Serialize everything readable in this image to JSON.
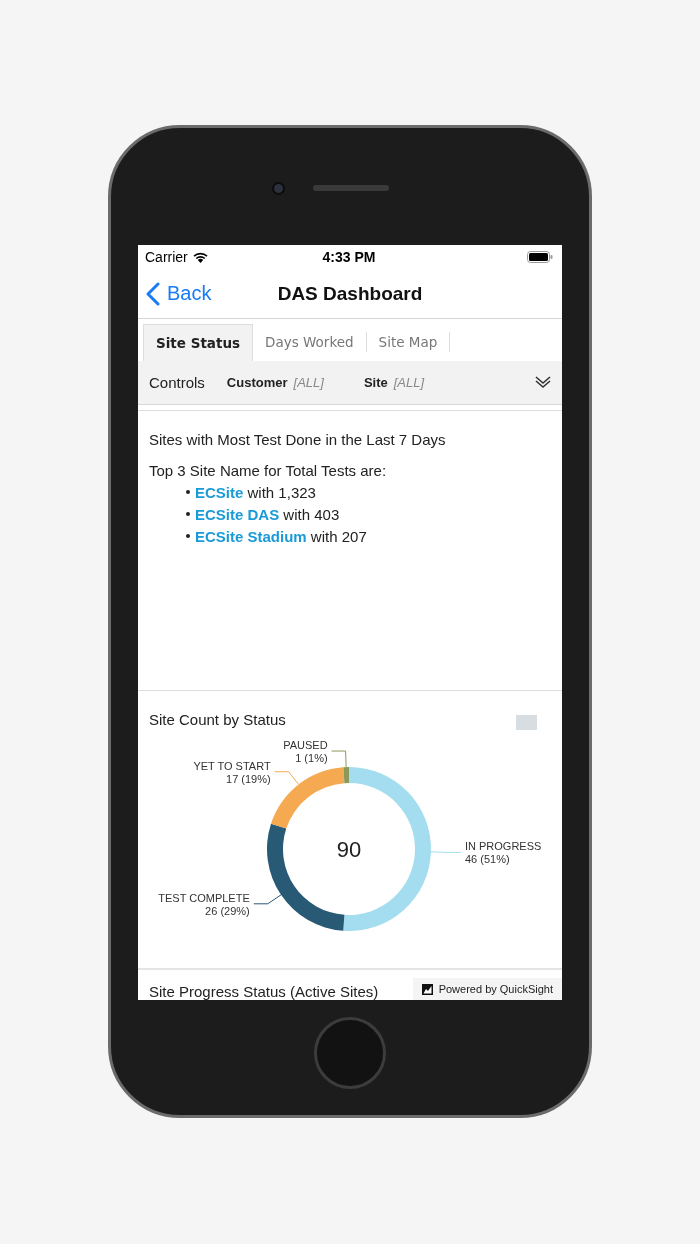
{
  "status_bar": {
    "carrier": "Carrier",
    "time": "4:33 PM"
  },
  "nav": {
    "back": "Back",
    "title": "DAS Dashboard"
  },
  "tabs": [
    {
      "label": "Site Status",
      "selected": true
    },
    {
      "label": "Days Worked",
      "selected": false
    },
    {
      "label": "Site Map",
      "selected": false
    }
  ],
  "controls": {
    "label": "Controls",
    "filters": [
      {
        "name": "Customer",
        "value": "[ALL]"
      },
      {
        "name": "Site",
        "value": "[ALL]"
      }
    ]
  },
  "insight": {
    "title": "Sites with Most Test Done in the Last 7 Days",
    "intro": "Top 3 Site Name for Total Tests are:",
    "items": [
      {
        "site": "ECSite",
        "detail": "with 1,323"
      },
      {
        "site": "ECSite DAS",
        "detail": "with 403"
      },
      {
        "site": "ECSite Stadium",
        "detail": "with 207"
      }
    ]
  },
  "chart_panel": {
    "title": "Site Count by Status",
    "center_label": "90",
    "chart_data": {
      "type": "donut",
      "categories": [
        "IN PROGRESS",
        "TEST COMPLETE",
        "YET TO START",
        "PAUSED"
      ],
      "values": [
        46,
        26,
        17,
        1
      ],
      "colors": [
        "#a3ddef",
        "#285a75",
        "#f5a951",
        "#8a9a5b"
      ],
      "value_labels": [
        "46 (51%)",
        "26 (29%)",
        "17 (19%)",
        "1 (1%)"
      ]
    }
  },
  "next_panel": {
    "title": "Site Progress Status (Active Sites)"
  },
  "badge": "Powered by QuickSight"
}
